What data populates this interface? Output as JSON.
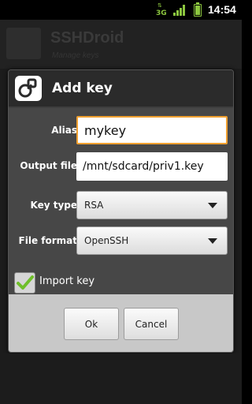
{
  "status_bar": {
    "network_label": "3G",
    "time": "14:54",
    "accent_color": "#8cc63f"
  },
  "background_app": {
    "title": "SSHDroid",
    "subtitle": "Manage keys"
  },
  "dialog": {
    "title": "Add key",
    "icon": "key-lock-icon",
    "fields": {
      "alias": {
        "label": "Alias",
        "value": "mykey"
      },
      "output_file": {
        "label": "Output file",
        "value": "/mnt/sdcard/priv1.key"
      },
      "key_type": {
        "label": "Key type",
        "selected": "RSA"
      },
      "file_format": {
        "label": "File format",
        "selected": "OpenSSH"
      }
    },
    "import_key": {
      "label": "Import key",
      "checked": true
    },
    "buttons": {
      "ok": "Ok",
      "cancel": "Cancel"
    },
    "focus_color": "#f0a030"
  }
}
